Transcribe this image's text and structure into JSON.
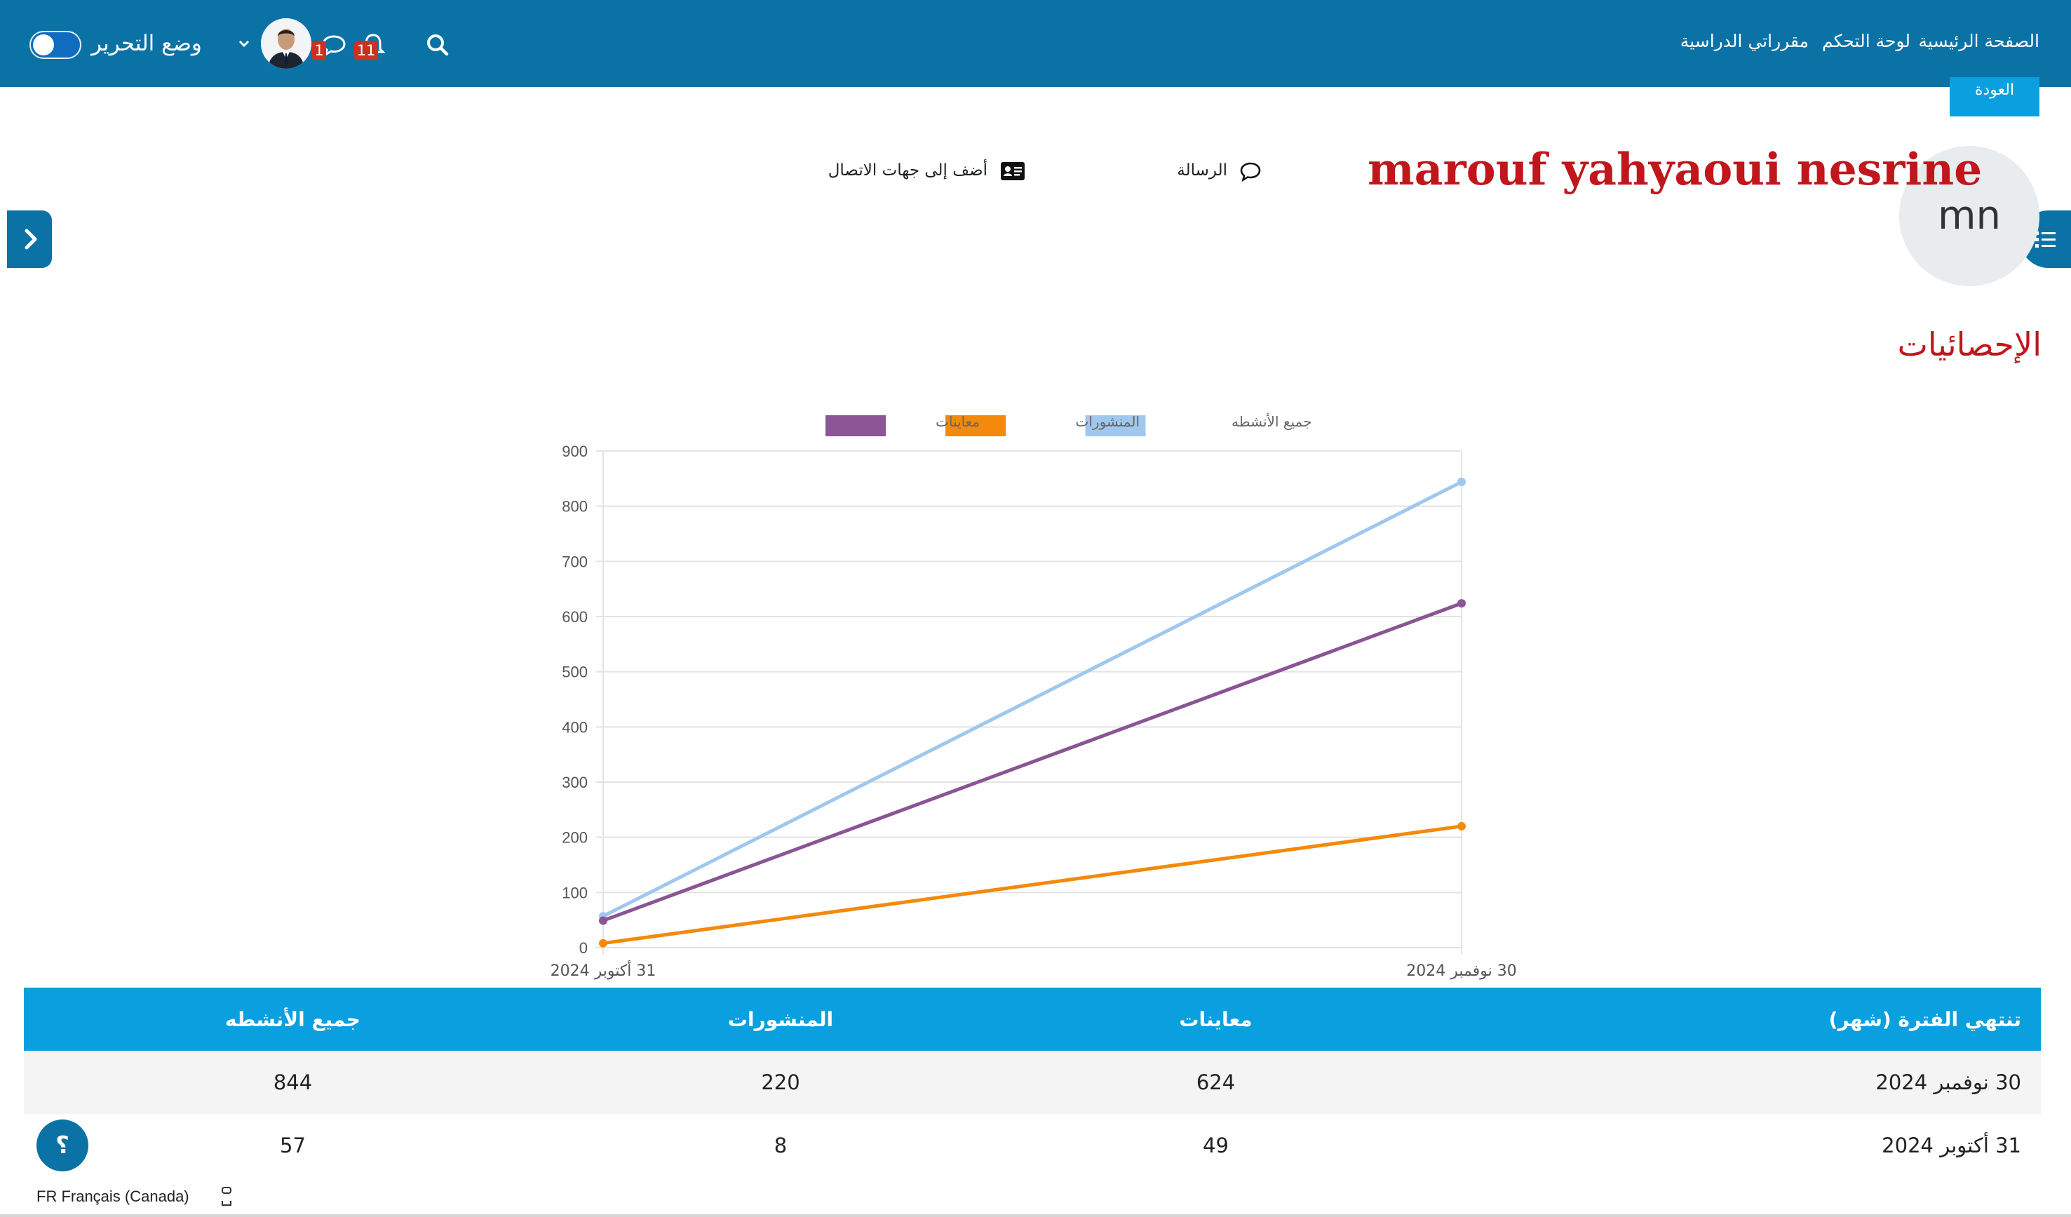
{
  "navbar": {
    "links": [
      "الصفحة الرئيسية",
      "لوحة التحكم",
      "مقرراتي الدراسية"
    ],
    "notifications_count": "11",
    "messages_count": "1",
    "edit_mode_label": "وضع التحرير",
    "accent": "#0b72a6"
  },
  "back_button": "العودة",
  "profile": {
    "initials": "mn",
    "name": "marouf yahyaoui nesrine",
    "message_label": "الرسالة",
    "add_contact_label": "أضف إلى جهات الاتصال"
  },
  "section_title": "الإحصائيات",
  "chart_data": {
    "type": "line",
    "x": [
      "31 أكتوبر 2024",
      "30 نوفمبر 2024"
    ],
    "ylim": [
      0,
      900
    ],
    "yticks": [
      0,
      100,
      200,
      300,
      400,
      500,
      600,
      700,
      800,
      900
    ],
    "grid": true,
    "legend_position": "top",
    "series": [
      {
        "name": "جميع الأنشطه",
        "values": [
          57,
          844
        ],
        "color": "#a0c8ee"
      },
      {
        "name": "المنشورات",
        "values": [
          8,
          220
        ],
        "color": "#f4890b"
      },
      {
        "name": "معاينات",
        "values": [
          49,
          624
        ],
        "color": "#8a5495"
      }
    ]
  },
  "table": {
    "headers": [
      "تنتهي الفترة (شهر)",
      "معاينات",
      "المنشورات",
      "جميع الأنشطه"
    ],
    "rows": [
      [
        "30 نوفمبر 2024",
        "624",
        "220",
        "844"
      ],
      [
        "31 أكتوبر 2024",
        "49",
        "8",
        "57"
      ]
    ]
  },
  "help_label": "؟",
  "language_label": "FR Français (Canada)"
}
